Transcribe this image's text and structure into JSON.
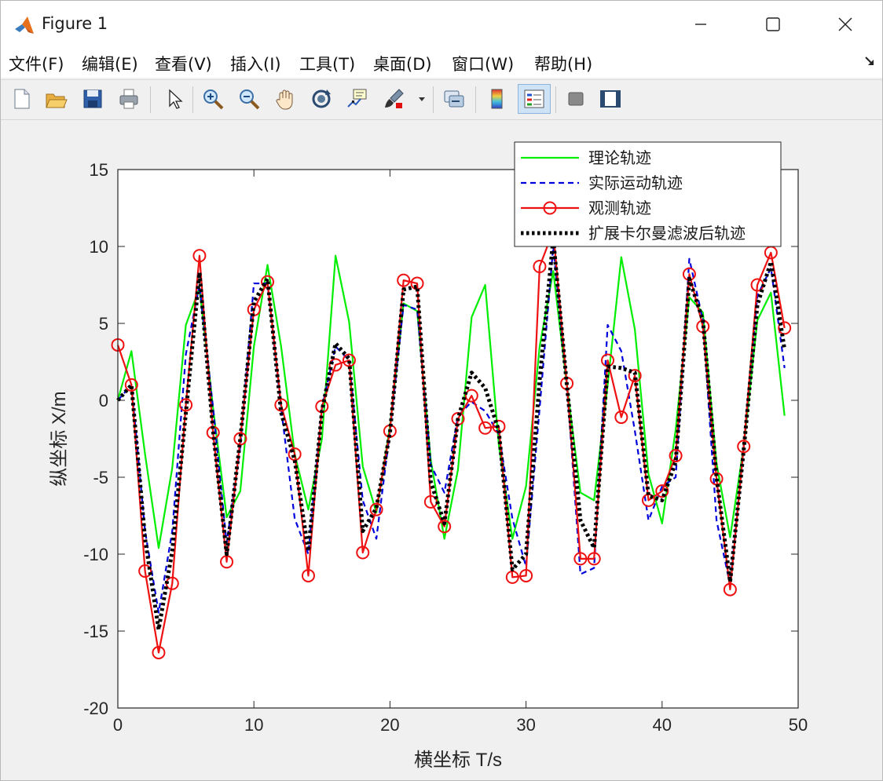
{
  "window": {
    "title": "Figure 1"
  },
  "menu": [
    {
      "label": "文件(F)"
    },
    {
      "label": "编辑(E)"
    },
    {
      "label": "查看(V)"
    },
    {
      "label": "插入(I)"
    },
    {
      "label": "工具(T)"
    },
    {
      "label": "桌面(D)"
    },
    {
      "label": "窗口(W)"
    },
    {
      "label": "帮助(H)"
    }
  ],
  "toolbar": [
    {
      "icon": "new-figure-icon"
    },
    {
      "icon": "open-file-icon"
    },
    {
      "icon": "save-icon"
    },
    {
      "icon": "print-icon"
    },
    {
      "icon": "pointer-icon"
    },
    {
      "icon": "zoom-in-icon"
    },
    {
      "icon": "zoom-out-icon"
    },
    {
      "icon": "pan-icon"
    },
    {
      "icon": "rotate-3d-icon"
    },
    {
      "icon": "data-cursor-icon"
    },
    {
      "icon": "brush-icon"
    },
    {
      "icon": "link-plot-icon"
    },
    {
      "icon": "colorbar-icon"
    },
    {
      "icon": "legend-icon"
    },
    {
      "icon": "hide-plot-tools-icon"
    },
    {
      "icon": "show-plot-tools-icon"
    }
  ],
  "colors": {
    "theory": "#00ee00",
    "actual": "#0000dd",
    "observed": "#ee1111",
    "filtered": "#000000"
  },
  "chart_data": {
    "type": "line",
    "title": "",
    "xlabel": "横坐标 T/s",
    "ylabel": "纵坐标 X/m",
    "xlim": [
      0,
      50
    ],
    "ylim": [
      -20,
      15
    ],
    "xticks": [
      0,
      10,
      20,
      30,
      40,
      50
    ],
    "yticks": [
      -20,
      -15,
      -10,
      -5,
      0,
      5,
      10,
      15
    ],
    "grid": false,
    "legend_position": "top-right",
    "series": [
      {
        "name": "理论轨迹",
        "style": "solid",
        "color": "#00ee00",
        "x": [
          0,
          1,
          2,
          3,
          4,
          5,
          6,
          7,
          8,
          9,
          10,
          11,
          12,
          13,
          14,
          15,
          16,
          17,
          18,
          19,
          20,
          21,
          22,
          23,
          24,
          25,
          26,
          27,
          28,
          29,
          30,
          31,
          32,
          33,
          34,
          35,
          36,
          37,
          38,
          39,
          40,
          41,
          42,
          43,
          44,
          45,
          46,
          47,
          48,
          49
        ],
        "y": [
          0,
          3.2,
          -3.5,
          -9.6,
          -4.4,
          4.9,
          7.3,
          -0.5,
          -7.6,
          -5.9,
          3.5,
          8.8,
          3.5,
          -3.5,
          -7.1,
          -2.5,
          9.4,
          5.1,
          -4.3,
          -7.3,
          -1.7,
          6.3,
          5.8,
          -3.9,
          -9.0,
          -4.5,
          5.4,
          7.5,
          -2.9,
          -9.0,
          -5.6,
          3.5,
          8.4,
          1.0,
          -6.0,
          -6.5,
          1.0,
          9.3,
          4.6,
          -4.8,
          -8.0,
          -1.9,
          6.7,
          5.7,
          -4.1,
          -8.9,
          -3.0,
          5.2,
          7.0,
          -1.0
        ]
      },
      {
        "name": "实际运动轨迹",
        "style": "dashed",
        "color": "#0000dd",
        "x": [
          0,
          1,
          2,
          3,
          4,
          5,
          6,
          7,
          8,
          9,
          10,
          11,
          12,
          13,
          14,
          15,
          16,
          17,
          18,
          19,
          20,
          21,
          22,
          23,
          24,
          25,
          26,
          27,
          28,
          29,
          30,
          31,
          32,
          33,
          34,
          35,
          36,
          37,
          38,
          39,
          40,
          41,
          42,
          43,
          44,
          45,
          46,
          47,
          48,
          49
        ],
        "y": [
          0,
          1.0,
          -8.5,
          -13.8,
          -8.5,
          3.0,
          7.5,
          -0.5,
          -9.3,
          -3.0,
          7.6,
          7.6,
          -0.5,
          -7.7,
          -10.0,
          -0.5,
          3.5,
          2.6,
          -6.5,
          -9.0,
          -2.0,
          6.2,
          5.9,
          -4.2,
          -6.0,
          -1.0,
          -0.1,
          -0.7,
          -2.2,
          -7.7,
          -10.8,
          -0.5,
          10.0,
          1.1,
          -11.3,
          -10.9,
          4.9,
          3.2,
          -2.0,
          -7.8,
          -5.6,
          -5.0,
          9.2,
          5.2,
          -7.8,
          -12.0,
          -3.0,
          6.8,
          8.6,
          2.1
        ]
      },
      {
        "name": "观测轨迹",
        "style": "solid-circle",
        "color": "#ee1111",
        "x": [
          0,
          1,
          2,
          3,
          4,
          5,
          6,
          7,
          8,
          9,
          10,
          11,
          12,
          13,
          14,
          15,
          16,
          17,
          18,
          19,
          20,
          21,
          22,
          23,
          24,
          25,
          26,
          27,
          28,
          29,
          30,
          31,
          32,
          33,
          34,
          35,
          36,
          37,
          38,
          39,
          40,
          41,
          42,
          43,
          44,
          45,
          46,
          47,
          48,
          49
        ],
        "y": [
          3.6,
          1.0,
          -11.1,
          -16.4,
          -11.9,
          -0.3,
          9.4,
          -2.1,
          -10.5,
          -2.5,
          5.9,
          7.7,
          -0.3,
          -3.5,
          -11.4,
          -0.4,
          2.3,
          2.6,
          -9.9,
          -7.1,
          -2.0,
          7.8,
          7.6,
          -6.6,
          -8.2,
          -1.2,
          0.3,
          -1.8,
          -1.7,
          -11.5,
          -11.4,
          8.7,
          11.0,
          1.1,
          -10.3,
          -10.3,
          2.6,
          -1.1,
          1.6,
          -6.5,
          -5.9,
          -3.6,
          8.2,
          4.8,
          -5.1,
          -12.3,
          -3.0,
          7.5,
          9.6,
          4.7
        ]
      },
      {
        "name": "扩展卡尔曼滤波后轨迹",
        "style": "dotted",
        "color": "#000000",
        "x": [
          0,
          1,
          2,
          3,
          4,
          5,
          6,
          7,
          8,
          9,
          10,
          11,
          12,
          13,
          14,
          15,
          16,
          17,
          18,
          19,
          20,
          21,
          22,
          23,
          24,
          25,
          26,
          27,
          28,
          29,
          30,
          31,
          32,
          33,
          34,
          35,
          36,
          37,
          38,
          39,
          40,
          41,
          42,
          43,
          44,
          45,
          46,
          47,
          48,
          49
        ],
        "y": [
          0,
          1.0,
          -9.0,
          -14.9,
          -9.8,
          -0.8,
          8.3,
          -2.0,
          -10.0,
          -2.5,
          6.4,
          7.9,
          -0.8,
          -3.9,
          -9.8,
          -0.7,
          3.7,
          2.7,
          -8.5,
          -7.0,
          -2.1,
          7.2,
          7.4,
          -5.3,
          -8.0,
          -1.2,
          1.8,
          0.8,
          -2.0,
          -11.0,
          -10.0,
          1.3,
          10.5,
          1.0,
          -7.8,
          -9.6,
          2.2,
          2.1,
          1.8,
          -6.2,
          -6.5,
          -4.0,
          7.9,
          5.2,
          -5.0,
          -11.8,
          -3.2,
          6.2,
          9.0,
          3.3
        ]
      }
    ]
  }
}
